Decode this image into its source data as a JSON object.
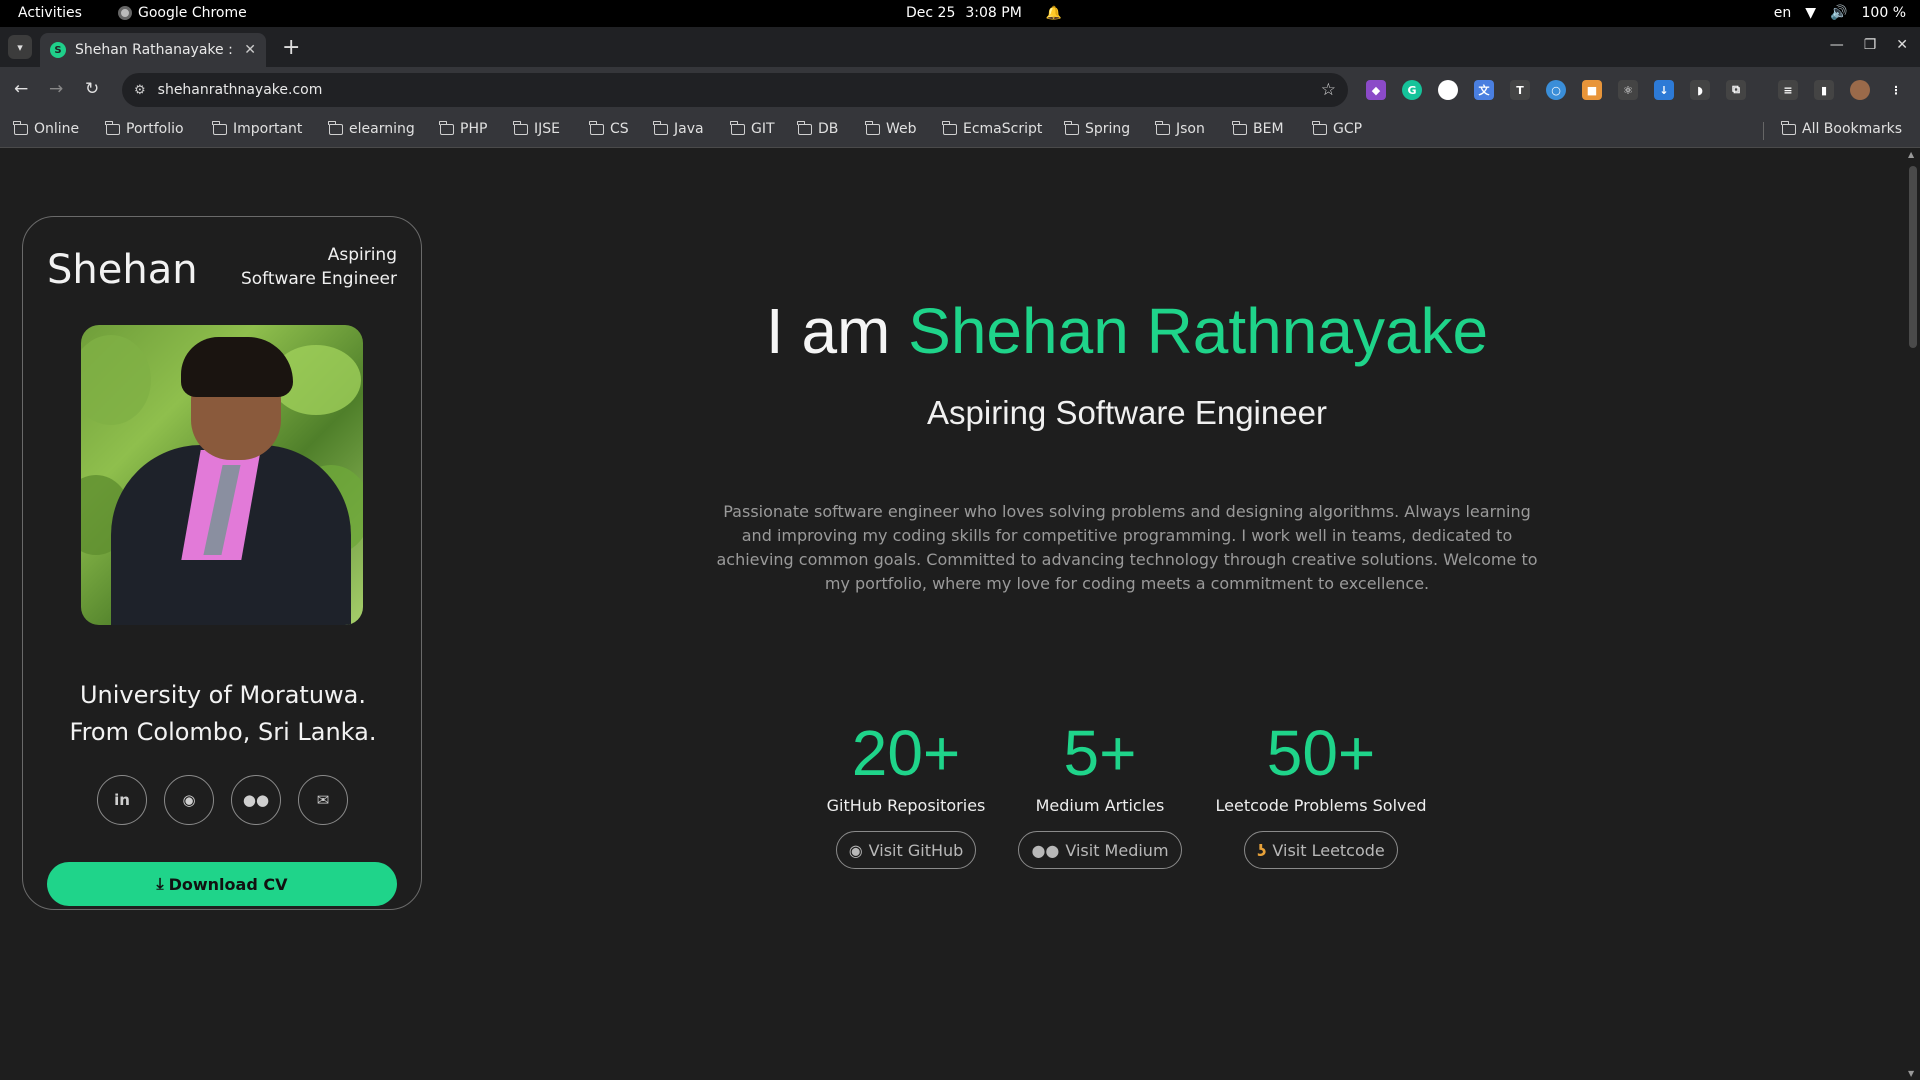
{
  "os_bar": {
    "activities": "Activities",
    "app_name": "Google Chrome",
    "date": "Dec 25",
    "time": "3:08 PM",
    "language": "en",
    "battery": "100 %"
  },
  "browser": {
    "tab_title": "Shehan Rathanayake : H",
    "url": "shehanrathnayake.com",
    "bookmarks": [
      "Online",
      "Portfolio",
      "Important",
      "elearning",
      "PHP",
      "IJSE",
      "CS",
      "Java",
      "GIT",
      "DB",
      "Web",
      "EcmaScript",
      "Spring",
      "Json",
      "BEM",
      "GCP"
    ],
    "all_bookmarks": "All Bookmarks"
  },
  "profile": {
    "name": "Shehan",
    "role_line1": "Aspiring",
    "role_line2": "Software Engineer",
    "university": "University of Moratuwa.",
    "location": "From Colombo, Sri Lanka.",
    "download_label": "Download CV",
    "socials": [
      "linkedin-icon",
      "github-icon",
      "medium-icon",
      "mail-icon"
    ]
  },
  "hero": {
    "prefix": "I am ",
    "name": "Shehan Rathnayake",
    "subtitle": "Aspiring Software Engineer",
    "description": "Passionate software engineer who loves solving problems and designing algorithms. Always learning and improving my coding skills for competitive programming. I work well in teams, dedicated to achieving common goals. Committed to advancing technology through creative solutions. Welcome to my portfolio, where my love for coding meets a commitment to excellence."
  },
  "stats": [
    {
      "value": "20+",
      "label": "GitHub Repositories",
      "button": "Visit GitHub"
    },
    {
      "value": "5+",
      "label": "Medium Articles",
      "button": "Visit Medium"
    },
    {
      "value": "50+",
      "label": "Leetcode Problems Solved",
      "button": "Visit Leetcode"
    }
  ],
  "colors": {
    "accent": "#1fd48a",
    "background": "#1e1e1e"
  }
}
